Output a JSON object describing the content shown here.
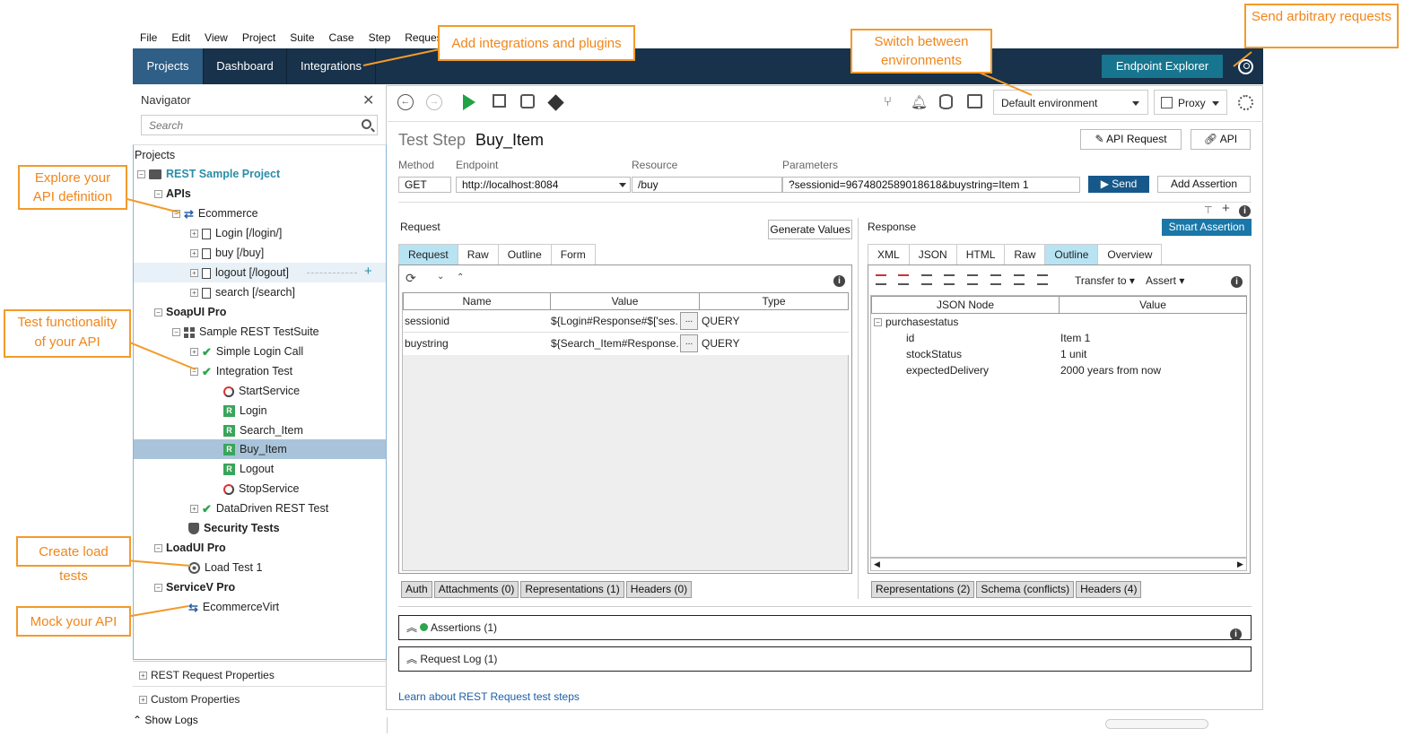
{
  "menu": [
    "File",
    "Edit",
    "View",
    "Project",
    "Suite",
    "Case",
    "Step",
    "Request"
  ],
  "topnav": {
    "tabs": [
      "Projects",
      "Dashboard",
      "Integrations"
    ],
    "active": "Projects",
    "endpoint_explorer": "Endpoint Explorer"
  },
  "navigator": {
    "title": "Navigator",
    "search_placeholder": "Search",
    "projects_label": "Projects",
    "tree": {
      "rest_project": "REST Sample Project",
      "apis": "APIs",
      "ecommerce": "Ecommerce",
      "login": "Login [/login/]",
      "buy": "buy [/buy]",
      "logout": "logout [/logout]",
      "search": "search [/search]",
      "soapui": "SoapUI Pro",
      "testsuite": "Sample REST TestSuite",
      "simple_login": "Simple Login Call",
      "integration": "Integration Test",
      "startservice": "StartService",
      "step_login": "Login",
      "search_item": "Search_Item",
      "buy_item": "Buy_Item",
      "step_logout": "Logout",
      "stopservice": "StopService",
      "datadriven": "DataDriven REST Test",
      "security": "Security Tests",
      "loadui": "LoadUI Pro",
      "loadtest": "Load Test 1",
      "servicev": "ServiceV Pro",
      "virt": "EcommerceVirt"
    },
    "rest_props": "REST Request Properties",
    "custom_props": "Custom Properties"
  },
  "toolbar": {
    "environment": "Default environment",
    "proxy": "Proxy"
  },
  "teststep": {
    "title": "Test Step",
    "name": "Buy_Item",
    "api_request": "API Request",
    "api": "API",
    "labels": {
      "method": "Method",
      "endpoint": "Endpoint",
      "resource": "Resource",
      "parameters": "Parameters"
    },
    "method": "GET",
    "endpoint": "http://localhost:8084",
    "resource": "/buy",
    "parameters": "?sessionid=9674802589018618&buystring=Item 1",
    "send": "Send",
    "add_assertion": "Add Assertion"
  },
  "request": {
    "heading": "Request",
    "generate_values": "Generate Values",
    "tabs": [
      "Request",
      "Raw",
      "Outline",
      "Form"
    ],
    "active_tab": "Request",
    "columns": [
      "Name",
      "Value",
      "Type"
    ],
    "rows": [
      {
        "name": "sessionid",
        "value": "${Login#Response#$['ses...",
        "type": "QUERY"
      },
      {
        "name": "buystring",
        "value": "${Search_Item#Response...",
        "type": "QUERY"
      }
    ],
    "bottom_tabs": [
      "Auth",
      "Attachments (0)",
      "Representations (1)",
      "Headers (0)"
    ]
  },
  "response": {
    "heading": "Response",
    "smart_assertion": "Smart Assertion",
    "tabs": [
      "XML",
      "JSON",
      "HTML",
      "Raw",
      "Outline",
      "Overview"
    ],
    "active_tab": "Outline",
    "transfer_to": "Transfer to",
    "assert": "Assert",
    "columns": [
      "JSON Node",
      "Value"
    ],
    "root": "purchasestatus",
    "nodes": [
      {
        "node": "id",
        "value": "Item 1"
      },
      {
        "node": "stockStatus",
        "value": "1 unit"
      },
      {
        "node": "expectedDelivery",
        "value": "2000 years from now"
      }
    ],
    "bottom_tabs": [
      "Representations (2)",
      "Schema (conflicts)",
      "Headers (4)"
    ]
  },
  "assertions": "Assertions (1)",
  "request_log": "Request Log (1)",
  "learn_link": "Learn about REST Request test steps",
  "show_logs": "Show Logs",
  "callouts": {
    "integrations": "Add integrations and plugins",
    "environments": "Switch between environments",
    "arbitrary": "Send arbitrary requests",
    "explore": "Explore your API definition",
    "test": "Test functionality of your API",
    "load": "Create load tests",
    "mock": "Mock your API"
  },
  "colors": {
    "nav_bg": "#17324a",
    "active_tab": "#2f5e86",
    "endpoint_btn": "#17758f",
    "callout": "#f39a2a",
    "selected_row": "#a9c4da"
  }
}
